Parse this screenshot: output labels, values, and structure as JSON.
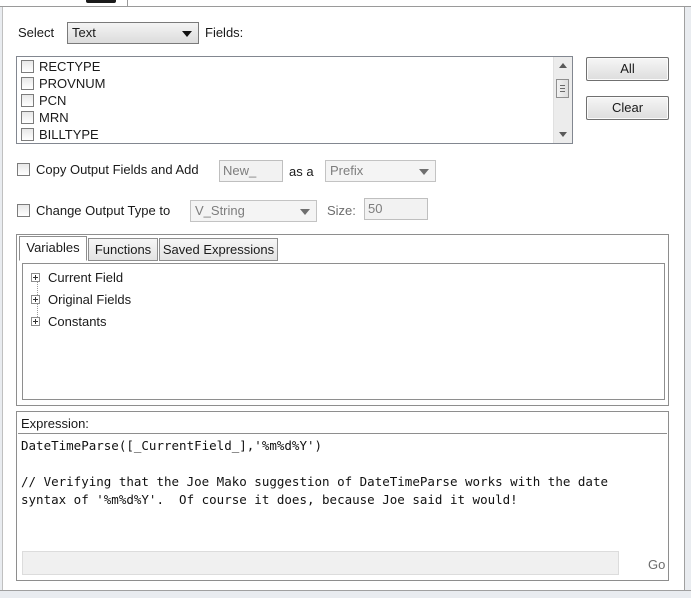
{
  "header": {
    "select_label": "Select",
    "type_value": "Text",
    "fields_label": "Fields:"
  },
  "fields": [
    {
      "name": "RECTYPE",
      "checked": false
    },
    {
      "name": "PROVNUM",
      "checked": false
    },
    {
      "name": "PCN",
      "checked": false
    },
    {
      "name": "MRN",
      "checked": false
    },
    {
      "name": "BILLTYPE",
      "checked": false
    }
  ],
  "buttons": {
    "all": "All",
    "clear": "Clear"
  },
  "copy_output": {
    "label": "Copy Output Fields and Add",
    "prefix_value": "New_",
    "as_a_label": "as a",
    "position_value": "Prefix",
    "checked": false
  },
  "change_type": {
    "label": "Change Output Type to",
    "type_value": "V_String",
    "size_label": "Size:",
    "size_value": "50",
    "checked": false
  },
  "tabs": [
    {
      "label": "Variables",
      "active": true
    },
    {
      "label": "Functions",
      "active": false
    },
    {
      "label": "Saved Expressions",
      "active": false
    }
  ],
  "tree": [
    {
      "label": "Current Field"
    },
    {
      "label": "Original Fields"
    },
    {
      "label": "Constants"
    }
  ],
  "expression": {
    "label": "Expression:",
    "lines": [
      "DateTimeParse([_CurrentField_],'%m%d%Y')",
      "",
      "// Verifying that the Joe Mako suggestion of DateTimeParse works with the date",
      "syntax of '%m%d%Y'.  Of course it does, because Joe said it would!"
    ]
  },
  "footer": {
    "go_label": "Go"
  },
  "colors": {
    "border": "#8e8e8e",
    "panel_bg": "#ffffff",
    "disabled_text": "#7d7d7d"
  },
  "icons": {
    "dropdown": "chevron-down-icon",
    "tree_expand": "plus-box-icon",
    "scroll_up": "scroll-up-icon",
    "scroll_down": "scroll-down-icon"
  }
}
